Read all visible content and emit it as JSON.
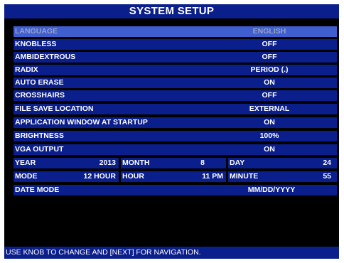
{
  "title": "SYSTEM SETUP",
  "settings": [
    {
      "label": "LANGUAGE",
      "value": "ENGLISH"
    },
    {
      "label": "KNOBLESS",
      "value": "OFF"
    },
    {
      "label": "AMBIDEXTROUS",
      "value": "OFF"
    },
    {
      "label": "RADIX",
      "value": "PERIOD (.)"
    },
    {
      "label": "AUTO ERASE",
      "value": "ON"
    },
    {
      "label": "CROSSHAIRS",
      "value": "OFF"
    },
    {
      "label": "FILE SAVE LOCATION",
      "value": "EXTERNAL"
    },
    {
      "label": "APPLICATION WINDOW AT STARTUP",
      "value": "ON"
    },
    {
      "label": "BRIGHTNESS",
      "value": "100%"
    },
    {
      "label": "VGA OUTPUT",
      "value": "ON"
    }
  ],
  "datetime": {
    "year": {
      "label": "YEAR",
      "value": "2013"
    },
    "month": {
      "label": "MONTH",
      "value": "8"
    },
    "day": {
      "label": "DAY",
      "value": "24"
    },
    "mode": {
      "label": "MODE",
      "value": "12 HOUR"
    },
    "hour": {
      "label": "HOUR",
      "value": "11 PM"
    },
    "minute": {
      "label": "MINUTE",
      "value": "55"
    },
    "date_mode": {
      "label": "DATE MODE",
      "value": "MM/DD/YYYY"
    }
  },
  "footer": "USE KNOB TO CHANGE AND [NEXT] FOR NAVIGATION.",
  "colors": {
    "background": "#000000",
    "row": "#0a1e8c",
    "selected_row": "#3f5ecf",
    "text": "#ffffff"
  }
}
